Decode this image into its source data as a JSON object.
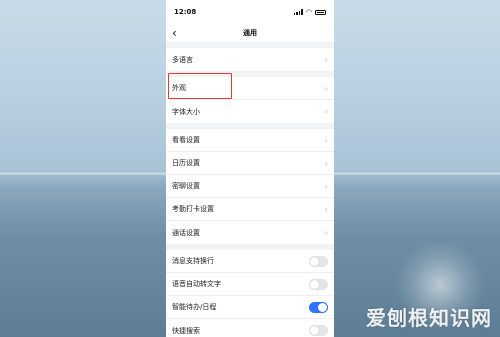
{
  "status_bar": {
    "time": "12:08"
  },
  "nav": {
    "back_icon": "chevron-left-icon",
    "title": "通用"
  },
  "groups": [
    {
      "items": [
        {
          "label": "多语言"
        }
      ]
    },
    {
      "items": [
        {
          "label": "外观"
        },
        {
          "label": "字体大小"
        }
      ]
    },
    {
      "items": [
        {
          "label": "看看设置"
        },
        {
          "label": "日历设置"
        },
        {
          "label": "密聊设置"
        },
        {
          "label": "考勤打卡设置"
        },
        {
          "label": "通话设置"
        }
      ]
    },
    {
      "toggles": [
        {
          "label": "消息支持换行",
          "on": false
        },
        {
          "label": "语音自动转文字",
          "on": false
        },
        {
          "label": "智能待办/日程",
          "on": true
        },
        {
          "label": "快捷搜索",
          "on": false
        }
      ]
    }
  ],
  "watermark": "爱刨根知识网",
  "colors": {
    "accent": "#2f73ff",
    "highlight_border": "#e53935"
  }
}
